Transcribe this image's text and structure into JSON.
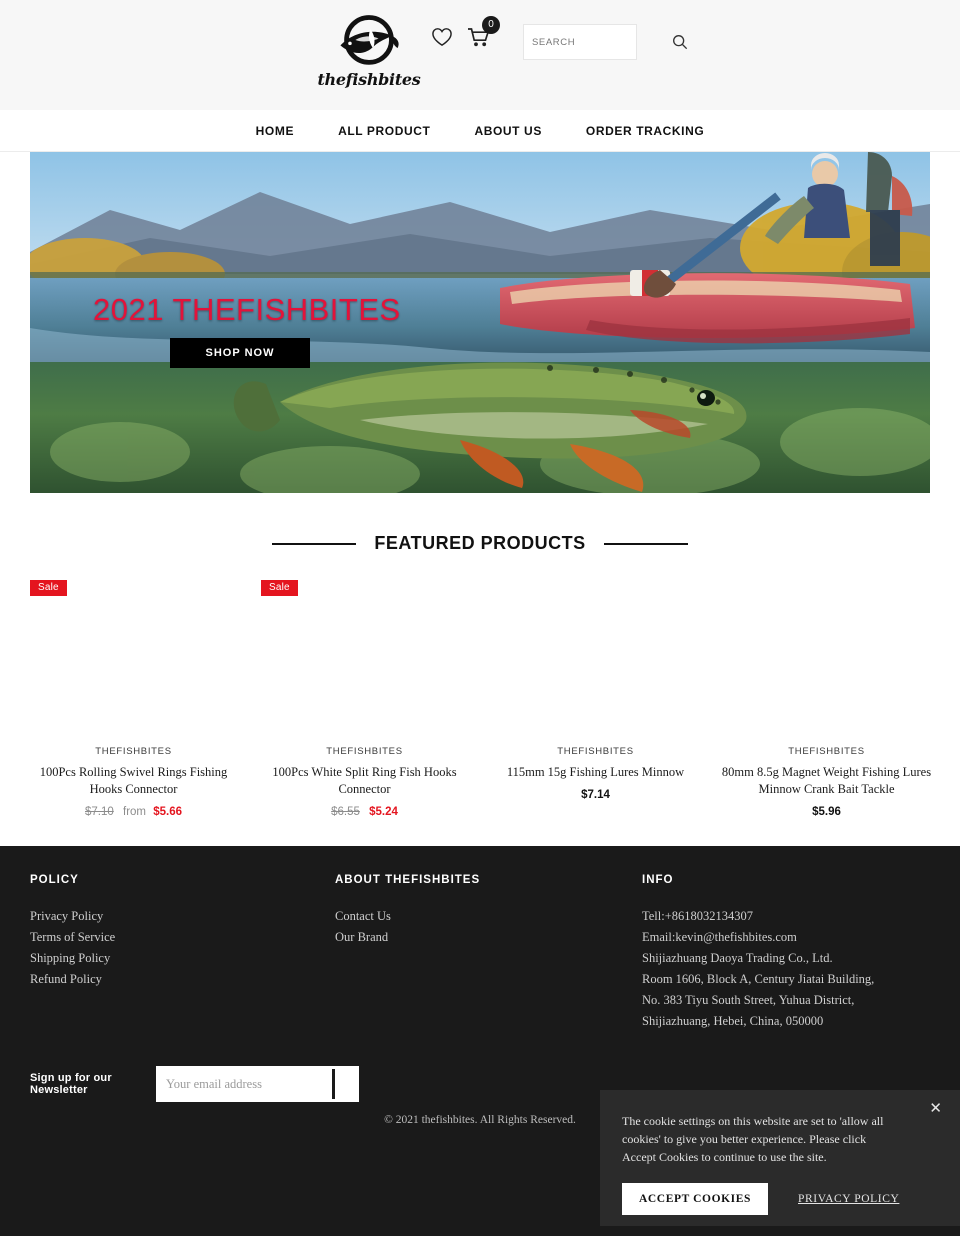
{
  "header": {
    "logo_text": "thefishbites",
    "logo_icon": "fish-logo-icon",
    "wishlist_icon": "heart-icon",
    "cart_icon": "cart-icon",
    "cart_count": "0",
    "search_placeholder": "SEARCH",
    "search_value": "",
    "search_icon": "magnifier-icon"
  },
  "nav": {
    "items": [
      {
        "label": "HOME"
      },
      {
        "label": "ALL PRODUCT"
      },
      {
        "label": "ABOUT US"
      },
      {
        "label": "ORDER TRACKING"
      }
    ]
  },
  "hero": {
    "title": "2021 THEFISHBITES",
    "title_color": "#e2133a",
    "button_label": "SHOP NOW",
    "scene": "fisherman-raft-above-water-trout-below-water"
  },
  "featured": {
    "heading": "FEATURED PRODUCTS",
    "products": [
      {
        "badge": "Sale",
        "vendor": "THEFISHBITES",
        "title": "100Pcs Rolling Swivel Rings Fishing Hooks Connector",
        "compare_price": "$7.10",
        "price_prefix": "from",
        "price": "$5.66",
        "on_sale": true
      },
      {
        "badge": "Sale",
        "vendor": "THEFISHBITES",
        "title": "100Pcs White Split Ring Fish Hooks Connector",
        "compare_price": "$6.55",
        "price_prefix": "",
        "price": "$5.24",
        "on_sale": true
      },
      {
        "badge": "",
        "vendor": "THEFISHBITES",
        "title": "115mm 15g Fishing Lures Minnow",
        "compare_price": "",
        "price_prefix": "",
        "price": "$7.14",
        "on_sale": false
      },
      {
        "badge": "",
        "vendor": "THEFISHBITES",
        "title": "80mm 8.5g Magnet Weight Fishing Lures Minnow Crank Bait Tackle",
        "compare_price": "",
        "price_prefix": "",
        "price": "$5.96",
        "on_sale": false
      }
    ]
  },
  "footer": {
    "policy": {
      "heading": "POLICY",
      "items": [
        {
          "label": "Privacy Policy"
        },
        {
          "label": "Terms of Service"
        },
        {
          "label": "Shipping Policy"
        },
        {
          "label": "Refund Policy"
        }
      ]
    },
    "about": {
      "heading": "ABOUT THEFISHBITES",
      "items": [
        {
          "label": "Contact Us"
        },
        {
          "label": "Our Brand"
        }
      ]
    },
    "info": {
      "heading": "INFO",
      "lines": [
        "Tell:+8618032134307",
        "Email:kevin@thefishbites.com",
        "Shijiazhuang Daoya Trading Co., Ltd.",
        "Room 1606, Block A, Century Jiatai Building,",
        "No. 383 Tiyu South Street, Yuhua District,",
        "Shijiazhuang, Hebei, China, 050000"
      ]
    },
    "newsletter": {
      "label": "Sign up for our Newsletter",
      "placeholder": "Your email address",
      "value": "",
      "submit_label": ""
    },
    "copyright": "© 2021 thefishbites. All Rights Reserved."
  },
  "cookie_banner": {
    "message": "The cookie settings on this website are set to 'allow all cookies' to give you better experience. Please click Accept Cookies to continue to use the site.",
    "accept_label": "ACCEPT COOKIES",
    "privacy_label": "PRIVACY POLICY",
    "close_icon": "close-icon",
    "close_label": "✕"
  },
  "colors": {
    "sale_red": "#e4151f",
    "hero_red": "#e2133a",
    "footer_bg": "#1a1a1a",
    "cookie_bg": "#2b2b2b"
  }
}
